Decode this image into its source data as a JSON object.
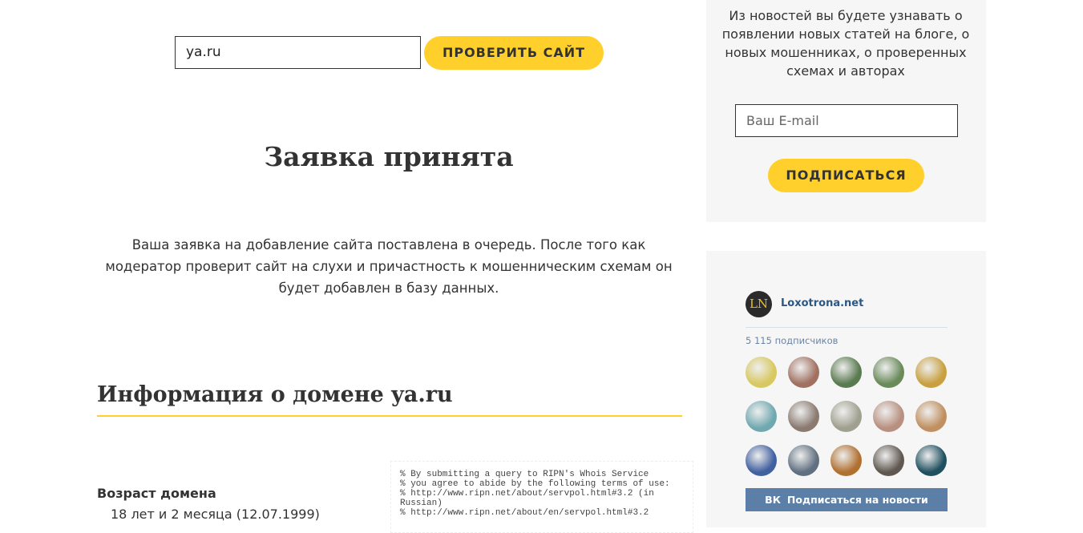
{
  "search": {
    "value": "ya.ru",
    "button": "ПРОВЕРИТЬ САЙТ"
  },
  "main": {
    "title": "Заявка принята",
    "message": "Ваша заявка на добавление сайта поставлена в очередь. После того как модератор проверит сайт на слухи и причастность к мошенническим схемам он будет добавлен в базу данных.",
    "info_heading": "Информация о домене ya.ru",
    "age_label": "Возраст домена",
    "age_value": "18 лет и 2 месяца (12.07.1999)",
    "whois": "% By submitting a query to RIPN's Whois Service\n% you agree to abide by the following terms of use:\n% http://www.ripn.net/about/servpol.html#3.2 (in Russian)\n% http://www.ripn.net/about/en/servpol.html#3.2"
  },
  "subscribe": {
    "text": "Из новостей вы будете узнавать о появлении новых статей на блоге, о новых мошенниках, о проверенных схемах и авторах",
    "email_placeholder": "Ваш E-mail",
    "button": "ПОДПИСАТЬСЯ"
  },
  "vk": {
    "logo": "LN",
    "name": "Loxotrona.net",
    "count": "5 115 подписчиков",
    "button": "Подписаться на новости",
    "icon": "vk-icon",
    "avatar_colors": [
      "#d8c860",
      "#a07060",
      "#5a7a50",
      "#6a8a5a",
      "#c8a040",
      "#70a8b0",
      "#8a7a70",
      "#a0a090",
      "#b89080",
      "#c09060",
      "#4060a0",
      "#607080",
      "#b07030",
      "#605850",
      "#205060"
    ]
  }
}
